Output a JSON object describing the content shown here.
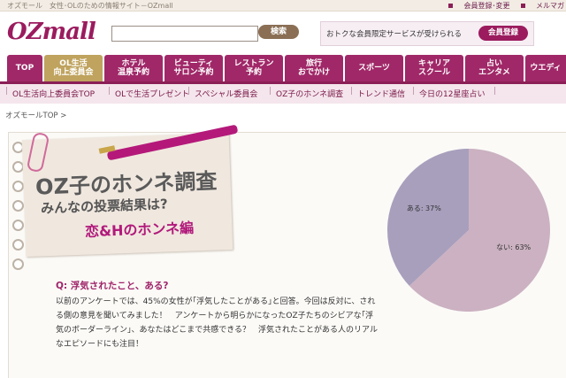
{
  "topbar": {
    "tagline": "オズモール　女性･OLのための情報サイト－OZmall",
    "link_register": "会員登録･変更",
    "link_mail": "メルマガ"
  },
  "header": {
    "logo": "OZmall",
    "search_placeholder": "",
    "search_button": "検索",
    "promo_text": "おトクな会員限定サービスが受けられる",
    "promo_button": "会員登録"
  },
  "nav": {
    "tabs": [
      {
        "label": "TOP"
      },
      {
        "label": "OL生活\n向上委員会"
      },
      {
        "label": "ホテル\n温泉予約"
      },
      {
        "label": "ビューティ\nサロン予約"
      },
      {
        "label": "レストラン\n予約"
      },
      {
        "label": "旅行\nおでかけ"
      },
      {
        "label": "スポーツ"
      },
      {
        "label": "キャリア\nスクール"
      },
      {
        "label": "占い\nエンタメ"
      },
      {
        "label": "ウエディ"
      }
    ]
  },
  "subnav": {
    "items": [
      {
        "label": "OL生活向上委員会TOP"
      },
      {
        "label": "OLで生活プレゼント"
      },
      {
        "label": "スペシャル委員会"
      },
      {
        "label": "OZ子のホンネ調査"
      },
      {
        "label": "トレンド通信"
      },
      {
        "label": "今日の12星座占い"
      }
    ]
  },
  "breadcrumb": "オズモールTOP >",
  "feature": {
    "title_line1": "OZ子のホンネ調査",
    "title_line2": "みんなの投票結果は?",
    "title_line3": "恋&Hのホンネ編"
  },
  "question": "Q: 浮気されたこと、ある?",
  "body_text": "以前のアンケートでは、45%の女性が｢浮気したことがある｣と回答。今回は反対に、される側の意見を聞いてみました！　アンケートから明らかになったOZ子たちのシビアな｢浮気のボーダーライン｣、あなたはどこまで共感できる？　浮気されたことがある人のリアルなエピソードにも注目！",
  "colors": {
    "brand": "#9b1b5e",
    "nav_active": "#bfa35e",
    "pie_yes": "#a89fbd",
    "pie_no": "#cbb1c1"
  },
  "chart_data": {
    "type": "pie",
    "slices": [
      {
        "label": "ある: 37%",
        "value": 37
      },
      {
        "label": "ない: 63%",
        "value": 63
      }
    ]
  }
}
